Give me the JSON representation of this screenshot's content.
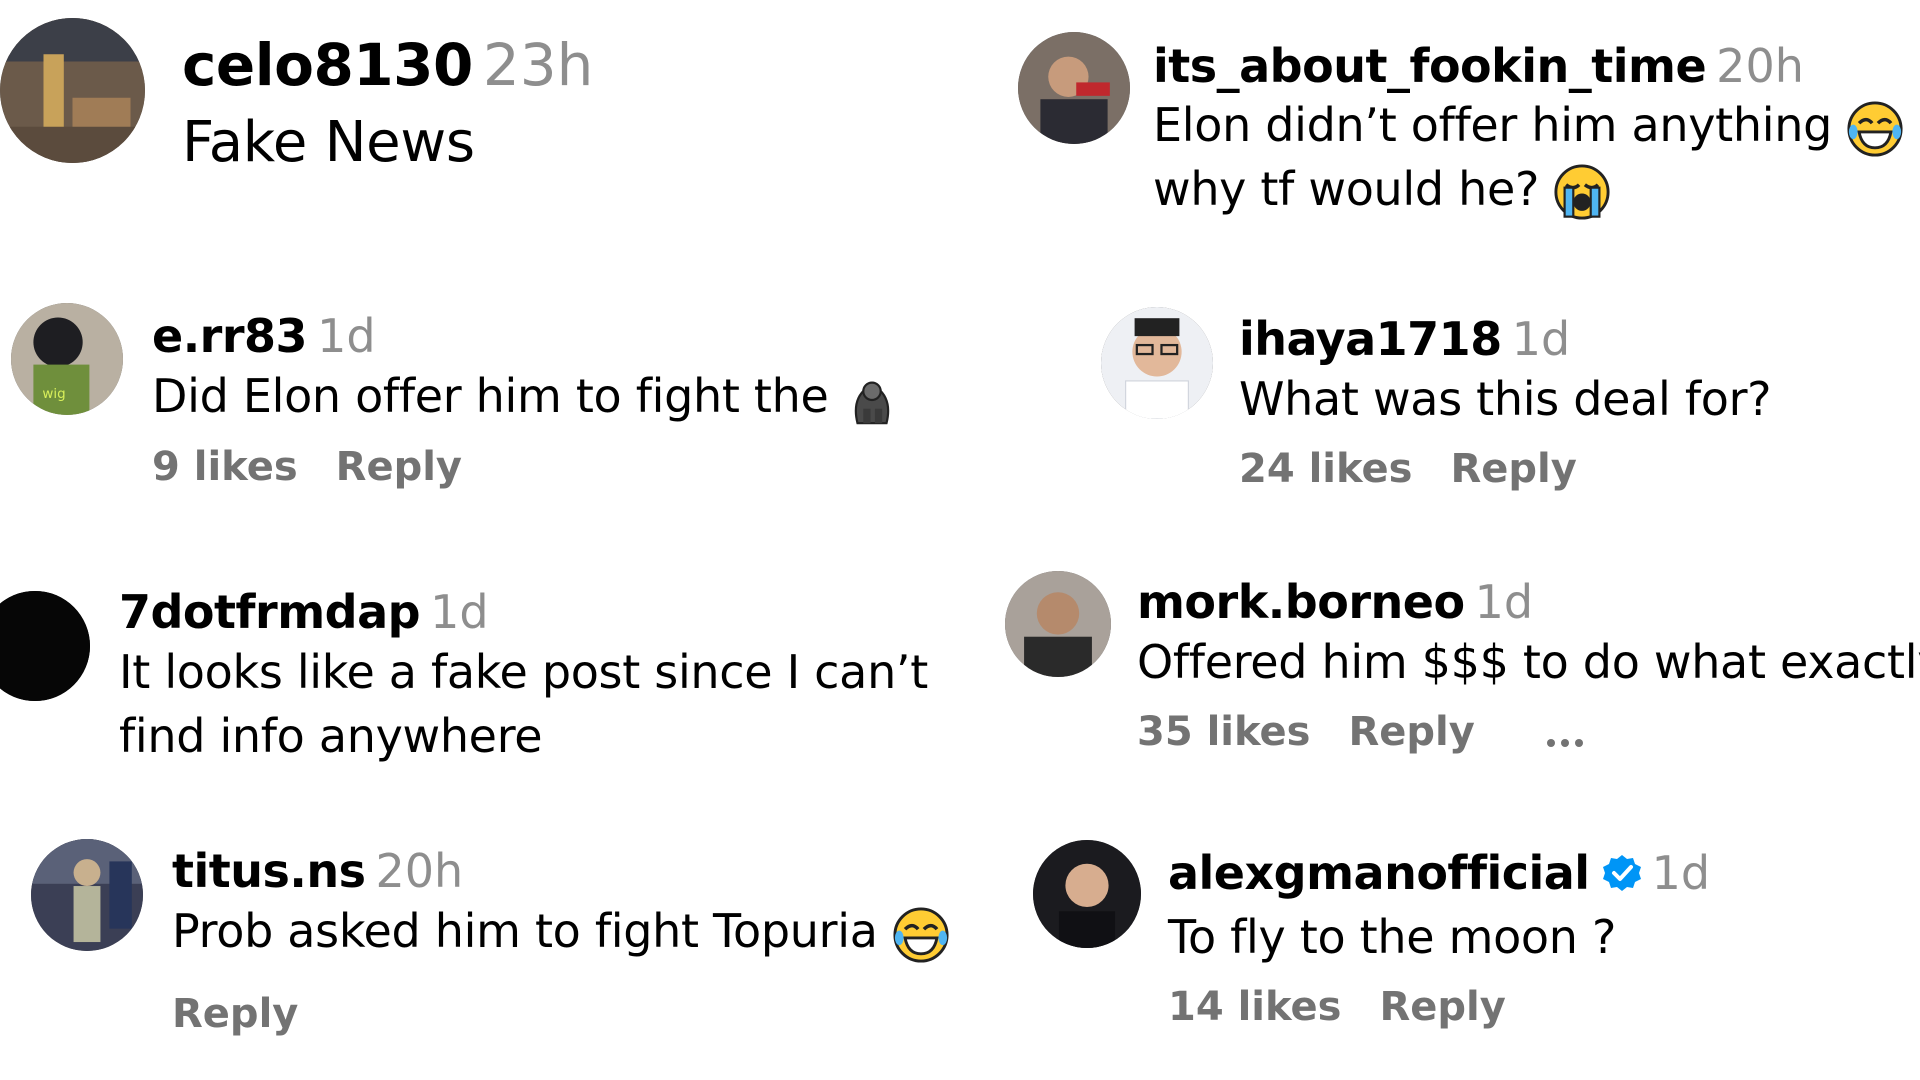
{
  "comments": [
    {
      "username": "celo8130",
      "time": "23h",
      "text": "Fake News"
    },
    {
      "username": "its_about_fookin_time",
      "time": "20h",
      "text_line1": "Elon didn’t offer him anything",
      "text_line2": "why tf would he?",
      "emoji1": "face-with-tears-of-joy-icon",
      "emoji2": "loudly-crying-face-icon"
    },
    {
      "username": "e.rr83",
      "time": "1d",
      "text": "Did Elon offer him to fight the",
      "emoji": "gorilla-icon",
      "likes": "9 likes",
      "reply": "Reply"
    },
    {
      "username": "ihaya1718",
      "time": "1d",
      "text": "What was this deal for?",
      "likes": "24 likes",
      "reply": "Reply"
    },
    {
      "username": "7dotfrmdap",
      "time": "1d",
      "text_line1": "It looks like a fake post since I can’t",
      "text_line2": "find info anywhere"
    },
    {
      "username": "mork.borneo",
      "time": "1d",
      "text": "Offered him $$$ to do what exactly?",
      "likes": "35 likes",
      "reply": "Reply",
      "more_icon": "more-options-icon"
    },
    {
      "username": "titus.ns",
      "time": "20h",
      "text": "Prob asked him to fight Topuria",
      "emoji": "face-with-tears-of-joy-icon",
      "reply": "Reply"
    },
    {
      "username": "alexgmanofficial",
      "time": "1d",
      "text": "To fly to the moon ?",
      "verified_icon": "verified-badge-icon",
      "likes": "14 likes",
      "reply": "Reply"
    }
  ],
  "colors": {
    "secondary_text": "#737373",
    "time_text": "#8e8e8e",
    "verified": "#0095f6"
  }
}
